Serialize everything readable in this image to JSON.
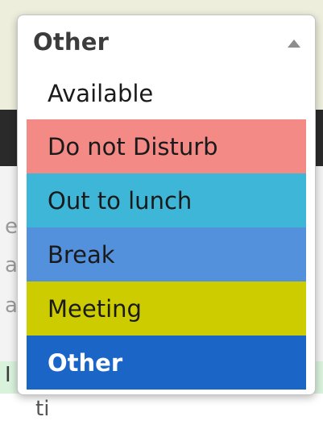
{
  "dropdown": {
    "selected_label": "Other",
    "caret_icon": "caret-up-icon",
    "options": [
      {
        "label": "Available",
        "color": "#ffffff",
        "selected": false
      },
      {
        "label": "Do not Disturb",
        "color": "#f48a86",
        "selected": false
      },
      {
        "label": "Out to lunch",
        "color": "#3eb6d8",
        "selected": false
      },
      {
        "label": "Break",
        "color": "#5391dd",
        "selected": false
      },
      {
        "label": "Meeting",
        "color": "#cccc00",
        "selected": false
      },
      {
        "label": "Other",
        "color": "#1b65c7",
        "selected": true
      }
    ]
  },
  "background": {
    "fragments": [
      "e",
      "a",
      "a",
      "I",
      "ti"
    ]
  }
}
